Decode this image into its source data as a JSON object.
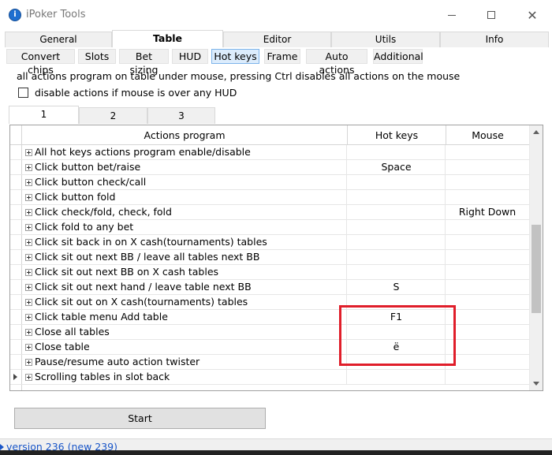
{
  "window": {
    "title": "iPoker Tools",
    "icon": "info-circle-icon"
  },
  "main_tabs": [
    {
      "label": "General",
      "active": false
    },
    {
      "label": "Table",
      "active": true
    },
    {
      "label": "Editor",
      "active": false
    },
    {
      "label": "Utils",
      "active": false
    },
    {
      "label": "Info",
      "active": false
    }
  ],
  "sub_tabs": [
    {
      "label": "Convert chips",
      "active": false
    },
    {
      "label": "Slots",
      "active": false
    },
    {
      "label": "Bet sizing",
      "active": false
    },
    {
      "label": "HUD",
      "active": false
    },
    {
      "label": "Hot keys",
      "active": true
    },
    {
      "label": "Frame",
      "active": false
    },
    {
      "label": "Auto actions",
      "active": false
    },
    {
      "label": "Additional",
      "active": false
    }
  ],
  "info_text": "all actions program on table under mouse, pressing Ctrl disables all actions on the mouse",
  "hud_checkbox": {
    "label": "disable actions if mouse is over any HUD",
    "checked": false
  },
  "number_tabs": [
    {
      "label": "1",
      "active": true
    },
    {
      "label": "2",
      "active": false
    },
    {
      "label": "3",
      "active": false
    }
  ],
  "grid": {
    "headers": {
      "action": "Actions program",
      "hotkey": "Hot keys",
      "mouse": "Mouse"
    },
    "rows": [
      {
        "action": "All hot keys actions program enable/disable",
        "hotkey": "",
        "mouse": ""
      },
      {
        "action": "Click button bet/raise",
        "hotkey": "Space",
        "mouse": ""
      },
      {
        "action": "Click button check/call",
        "hotkey": "",
        "mouse": ""
      },
      {
        "action": "Click button fold",
        "hotkey": "",
        "mouse": ""
      },
      {
        "action": "Click check/fold, check, fold",
        "hotkey": "",
        "mouse": "Right Down"
      },
      {
        "action": "Click fold to any bet",
        "hotkey": "",
        "mouse": ""
      },
      {
        "action": "Click sit back in on X cash(tournaments) tables",
        "hotkey": "",
        "mouse": ""
      },
      {
        "action": "Click sit out next BB / leave all tables next BB",
        "hotkey": "",
        "mouse": ""
      },
      {
        "action": "Click sit out next BB on X cash tables",
        "hotkey": "",
        "mouse": ""
      },
      {
        "action": "Click sit out next hand / leave table next BB",
        "hotkey": "S",
        "mouse": ""
      },
      {
        "action": "Click sit out on X cash(tournaments) tables",
        "hotkey": "",
        "mouse": ""
      },
      {
        "action": "Click table menu Add table",
        "hotkey": "F1",
        "mouse": ""
      },
      {
        "action": "Close all tables",
        "hotkey": "",
        "mouse": ""
      },
      {
        "action": "Close table",
        "hotkey": "ё",
        "mouse": ""
      },
      {
        "action": "Pause/resume auto action twister",
        "hotkey": "",
        "mouse": ""
      },
      {
        "action": "Scrolling tables in slot back",
        "hotkey": "",
        "mouse": ""
      }
    ]
  },
  "start_button": "Start",
  "status": {
    "version_text": "version 236 (new 239)"
  },
  "colors": {
    "highlight": "#e01e2a",
    "link": "#1a56c8",
    "active_subtab": "#dcecfc"
  }
}
